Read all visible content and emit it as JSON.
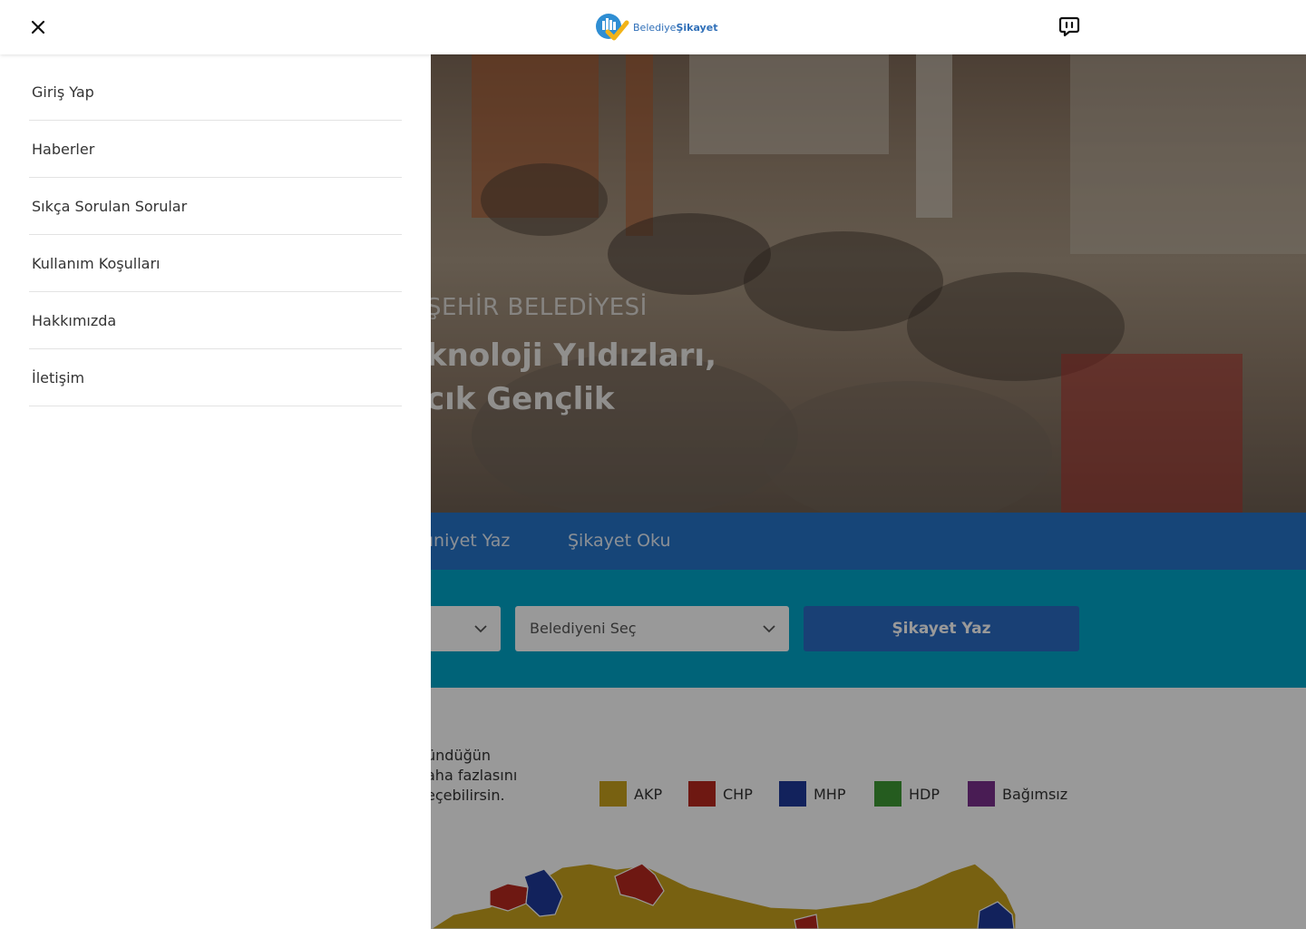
{
  "header": {
    "close_icon": "close-icon",
    "logo": {
      "part1": "Belediye",
      "part2": "Şikayet"
    },
    "chat_icon": "chat-icon"
  },
  "drawer": {
    "items": [
      {
        "label": "Giriş Yap"
      },
      {
        "label": "Haberler"
      },
      {
        "label": "Sıkça Sorulan Sorular"
      },
      {
        "label": "Kullanım Koşulları"
      },
      {
        "label": "Hakkımızda"
      },
      {
        "label": "İletişim"
      }
    ]
  },
  "hero": {
    "subtitle": "ŞEHİR BELEDİYESİ",
    "title_line1": "knoloji Yıldızları,",
    "title_line2": "cık Gençlik"
  },
  "tabs": [
    {
      "label": "uniyet Yaz"
    },
    {
      "label": "Şikayet Oku"
    }
  ],
  "search": {
    "municipality_select": "Belediyeni Seç",
    "submit_label": "Şikayet Yaz"
  },
  "map_section": {
    "desc_line1": "ündüğün",
    "desc_line2": "aha fazlasını",
    "desc_line3": "eçebilirsin.",
    "legend": [
      {
        "label": "AKP",
        "color": "#c9a21d"
      },
      {
        "label": "CHP",
        "color": "#b8291f"
      },
      {
        "label": "MHP",
        "color": "#1f3a9a"
      },
      {
        "label": "HDP",
        "color": "#3f9a35"
      },
      {
        "label": "Bağımsız",
        "color": "#7a2f8c"
      }
    ]
  },
  "colors": {
    "tabs_bar": "#2673c9",
    "search_band": "#00a5c9",
    "cta": "#2b6cc4",
    "overlay": "rgba(0,0,0,0.4)"
  }
}
